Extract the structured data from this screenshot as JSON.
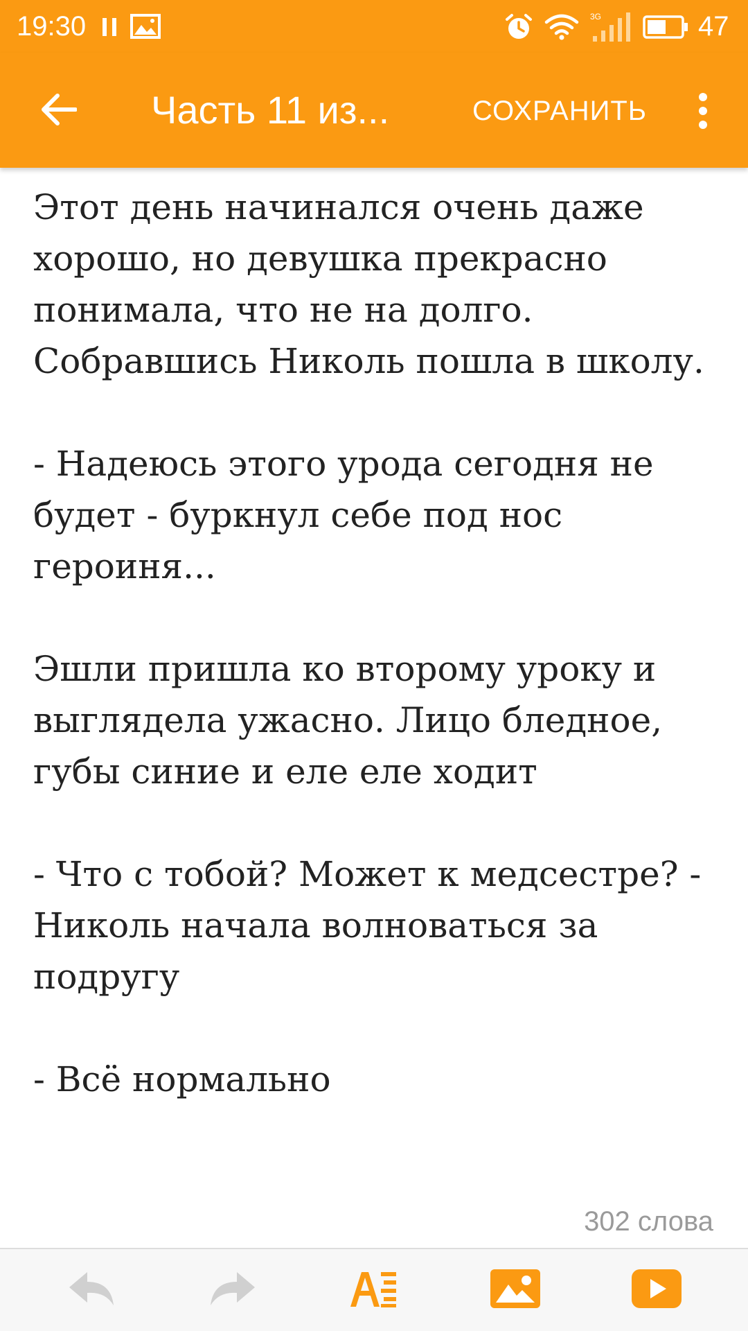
{
  "status_bar": {
    "time": "19:30",
    "battery_level": "47",
    "signal_label": "3G"
  },
  "app_bar": {
    "title": "Часть 11 из...",
    "save_label": "СОХРАНИТЬ"
  },
  "story": {
    "paragraphs": [
      "Этот день начинался очень даже хорошо, но девушка прекрасно понимала, что не на долго. Собравшись Николь пошла в школу.",
      "- Надеюсь этого урода сегодня не будет - буркнул себе под нос героиня...",
      "Эшли пришла ко второму уроку и выглядела ужасно. Лицо бледное, губы синие и еле еле ходит",
      "- Что с тобой? Может к медсестре? - Николь начала волноваться за подругу",
      "- Всё нормально"
    ]
  },
  "word_count": "302 слова",
  "toolbar": {
    "items": [
      "undo-icon",
      "redo-icon",
      "text-format-icon",
      "image-icon",
      "video-icon"
    ]
  },
  "colors": {
    "accent": "#fb9a12",
    "disabled_icon": "#cfcfcf",
    "text": "#222222",
    "muted_text": "#9a9a9a"
  }
}
